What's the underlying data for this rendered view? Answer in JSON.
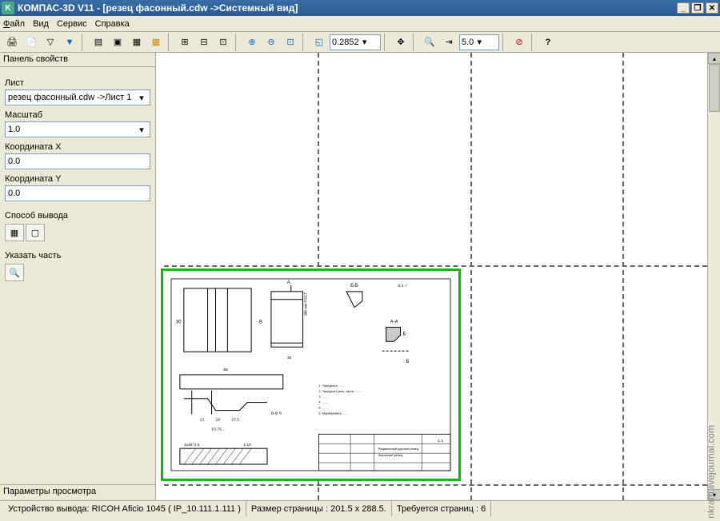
{
  "titlebar": {
    "app_icon_letter": "K",
    "title": "КОМПАС-3D V11 - [резец фасонный.cdw ->Системный вид]"
  },
  "menus": {
    "file": "Файл",
    "view": "Вид",
    "service": "Сервис",
    "help": "Справка"
  },
  "toolbar": {
    "zoom_value": "0.2852",
    "step_value": "5.0"
  },
  "panel": {
    "title": "Панель свойств",
    "sheet_label": "Лист",
    "sheet_value": "резец фасонный.cdw ->Лист 1",
    "scale_label": "Масштаб",
    "scale_value": "1.0",
    "coordx_label": "Координата X",
    "coordx_value": "0.0",
    "coordy_label": "Координата Y",
    "coordy_value": "0.0",
    "output_label": "Способ вывода",
    "specify_label": "Указать часть",
    "tab_label": "Параметры просмотра"
  },
  "status": {
    "device": "Устройство вывода: RICOH Aficio 1045 ( IP_10.111.1.111 )",
    "pagesize": "Размер страницы : 201.5 x 288.5.",
    "pages": "Требуется страниц : 6"
  },
  "watermark": "nkram.livejournal.com",
  "icons": {
    "print": "🖨",
    "preview": "📄",
    "filter": "▽",
    "layers": "▤",
    "color1": "▣",
    "color2": "▦",
    "grid1": "⊞",
    "grid2": "⊟",
    "grid3": "⊡",
    "zoomin": "🔍+",
    "zoomout": "🔍-",
    "zoomfit": "⤢",
    "zoomsel": "⬚",
    "refresh": "↻",
    "pan": "✥",
    "zoom2": "🔍",
    "step": "⇥",
    "stop": "⛔",
    "help": "?"
  }
}
